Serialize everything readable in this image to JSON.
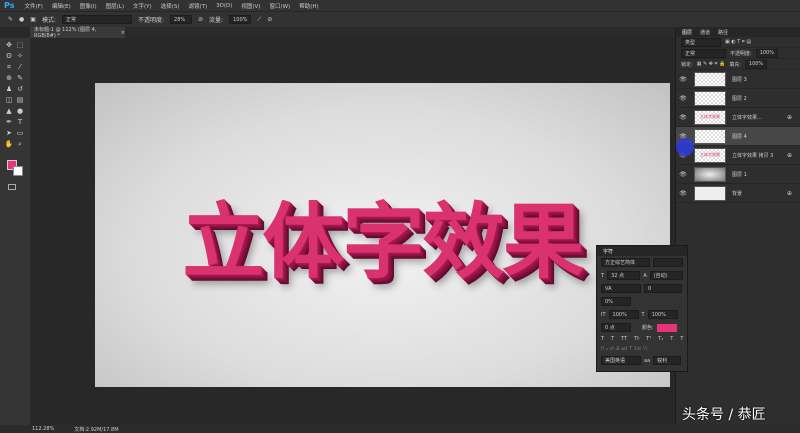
{
  "menubar": {
    "logo": "Ps",
    "items": [
      "文件(F)",
      "编辑(E)",
      "图像(I)",
      "图层(L)",
      "文字(Y)",
      "选择(S)",
      "滤镜(T)",
      "3D(D)",
      "视图(V)",
      "窗口(W)",
      "帮助(H)"
    ]
  },
  "options": {
    "mode_label": "模式:",
    "mode_value": "正常",
    "opacity_label": "不透明度:",
    "opacity_value": "28%",
    "flow_label": "流量:",
    "flow_value": "100%"
  },
  "document_tab": {
    "title": "未标题-1 @ 112% (图层 4, RGB/8#) *",
    "close": "×"
  },
  "canvas": {
    "headline": "立体字效果",
    "headline_color": "#d9326f"
  },
  "layers_panel": {
    "tabs": [
      "图层",
      "通道",
      "路径"
    ],
    "filter": "类型",
    "blend": "正常",
    "opacity_label": "不透明度:",
    "opacity": "100%",
    "lock_label": "锁定:",
    "fill_label": "填充:",
    "fill": "100%",
    "layers": [
      {
        "name": "图层 3",
        "thumb": "",
        "selected": false,
        "lock": false
      },
      {
        "name": "图层 2",
        "thumb": "",
        "selected": false,
        "lock": false
      },
      {
        "name": "立体字效果...",
        "thumb": "立体字效果",
        "selected": false,
        "lock": true
      },
      {
        "name": "图层 4",
        "thumb": "",
        "selected": true,
        "lock": false
      },
      {
        "name": "立体字效果 拷贝 3",
        "thumb": "立体字效果",
        "selected": false,
        "lock": true
      },
      {
        "name": "图层 1",
        "thumb": "",
        "selected": false,
        "lock": false
      },
      {
        "name": "背景",
        "thumb": "",
        "selected": false,
        "lock": true
      }
    ]
  },
  "character_panel": {
    "title": "字符",
    "font": "方正综艺简体",
    "size": "32 点",
    "leading": "(自动)",
    "kerning": "VA",
    "tracking": "0",
    "scale_tracking": "0%",
    "vscale": "100%",
    "hscale": "100%",
    "baseline": "0 点",
    "color_label": "颜色:",
    "color": "#e8327a",
    "styles": [
      "T",
      "T",
      "TT",
      "Tt",
      "T¹",
      "T₁",
      "T",
      "T"
    ],
    "language": "美国英语",
    "aa_label": "aa",
    "aa": "锐利"
  },
  "status": {
    "zoom": "112.28%",
    "doc": "文档:2.92M/17.8M"
  },
  "watermark": "头条号 / 恭匠"
}
